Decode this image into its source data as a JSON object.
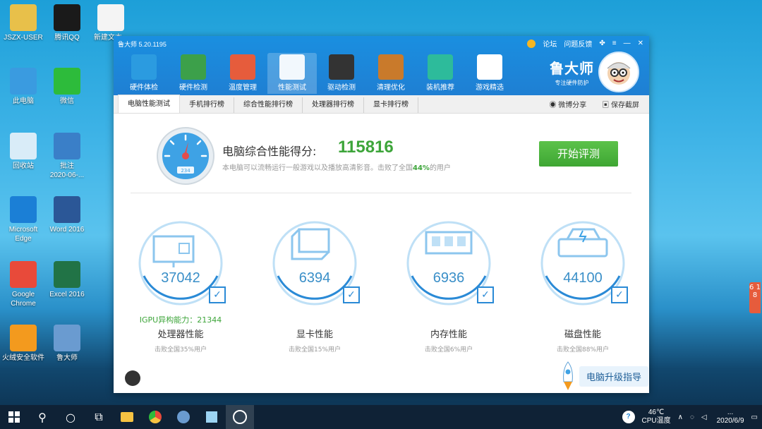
{
  "desktop": {
    "icons": [
      {
        "label": "JSZX-USER",
        "icon": "folder-user-icon",
        "color": "#e8c04a"
      },
      {
        "label": "腾讯QQ",
        "icon": "qq-icon",
        "color": "#1a1a1a"
      },
      {
        "label": "新建文本...",
        "icon": "text-file-icon",
        "color": "#f4f4f4"
      },
      {
        "label": "此电脑",
        "icon": "computer-icon",
        "color": "#3a9be0"
      },
      {
        "label": "微信",
        "icon": "wechat-icon",
        "color": "#2dbb3b"
      },
      {
        "label": "回收站",
        "icon": "recycle-bin-icon",
        "color": "#d9ecf8"
      },
      {
        "label": "批注\n2020-06-...",
        "icon": "screenshot-icon",
        "color": "#3a7fc8"
      },
      {
        "label": "Microsoft\nEdge",
        "icon": "edge-icon",
        "color": "#1b7fd6"
      },
      {
        "label": "Word 2016",
        "icon": "word-icon",
        "color": "#2b5797"
      },
      {
        "label": "Google\nChrome",
        "icon": "chrome-icon",
        "color": "#e84a3a"
      },
      {
        "label": "Excel 2016",
        "icon": "excel-icon",
        "color": "#217346"
      },
      {
        "label": "火绒安全软件",
        "icon": "huorong-icon",
        "color": "#f39a1e"
      },
      {
        "label": "鲁大师",
        "icon": "ludashi-icon",
        "color": "#6a9bd0"
      }
    ]
  },
  "window": {
    "title": "鲁大师 5.20.1195",
    "controls": {
      "forum": "论坛",
      "feedback": "问题反馈"
    },
    "brand": {
      "name": "鲁大师",
      "slogan": "专注硬件防护"
    },
    "nav": [
      {
        "label": "硬件体检",
        "icon": "hardware-check-icon",
        "active": false
      },
      {
        "label": "硬件检测",
        "icon": "hardware-detect-icon",
        "active": false
      },
      {
        "label": "温度管理",
        "icon": "temperature-icon",
        "active": false
      },
      {
        "label": "性能测试",
        "icon": "performance-gauge-icon",
        "active": true
      },
      {
        "label": "驱动检测",
        "icon": "driver-icon",
        "active": false
      },
      {
        "label": "清理优化",
        "icon": "broom-icon",
        "active": false
      },
      {
        "label": "装机推荐",
        "icon": "cube-icon",
        "active": false
      },
      {
        "label": "游戏精选",
        "icon": "gamepad-icon",
        "active": false
      }
    ],
    "tabs": [
      "电脑性能测试",
      "手机排行榜",
      "综合性能排行榜",
      "处理器排行榜",
      "显卡排行榜"
    ],
    "tab_actions": {
      "share": "微博分享",
      "screenshot": "保存截屏"
    },
    "score": {
      "label": "电脑综合性能得分:",
      "value": "115816",
      "desc_before": "本电脑可以流畅运行一般游戏以及播放高清影音。击败了全国",
      "desc_pct": "44%",
      "desc_after": "的用户",
      "gauge_reading": "234"
    },
    "start_button": "开始评测",
    "metrics": [
      {
        "value": "37042",
        "extra": "IGPU异构能力：21344",
        "name": "处理器性能",
        "sub": "击败全国35%用户",
        "icon": "cpu-monitor-icon"
      },
      {
        "value": "6394",
        "extra": "",
        "name": "显卡性能",
        "sub": "击败全国15%用户",
        "icon": "gpu-cube-icon"
      },
      {
        "value": "6936",
        "extra": "",
        "name": "内存性能",
        "sub": "击败全国6%用户",
        "icon": "memory-chip-icon"
      },
      {
        "value": "44100",
        "extra": "",
        "name": "磁盘性能",
        "sub": "击败全国88%用户",
        "icon": "disk-drive-icon"
      }
    ],
    "guide": "电脑升级指导"
  },
  "taskbar": {
    "temp_value": "46℃",
    "temp_label": "CPU温度",
    "time": "...",
    "date": "2020/6/9",
    "side_tab": "6 1 8"
  },
  "colors": {
    "accent": "#1f86d8",
    "score_green": "#3da53a",
    "ring_blue": "#2a8ad6"
  }
}
